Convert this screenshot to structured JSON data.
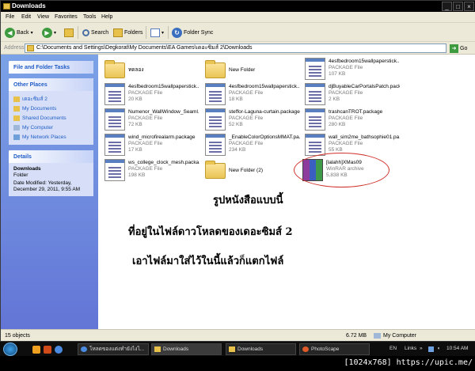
{
  "window": {
    "title": "Downloads",
    "controls": [
      "_",
      "□",
      "×"
    ]
  },
  "menu": [
    "File",
    "Edit",
    "View",
    "Favorites",
    "Tools",
    "Help"
  ],
  "toolbar": {
    "back": "Back",
    "search": "Search",
    "folders": "Folders",
    "folder_sync": "Folder Sync"
  },
  "address": {
    "label": "Address",
    "path": "C:\\Documents and Settings\\Degkorat\\My Documents\\EA Games\\เดอะซิมส์ 2\\Downloads",
    "go": "Go"
  },
  "sidebar": {
    "tasks_title": "File and Folder Tasks",
    "places_title": "Other Places",
    "places": [
      "เดอะซิมส์ 2",
      "My Documents",
      "Shared Documents",
      "My Computer",
      "My Network Places"
    ],
    "details_title": "Details",
    "details_name": "Downloads",
    "details_type": "Folder",
    "details_modified_1": "Date Modified: Yesterday,",
    "details_modified_2": "December 29, 2011, 9:55 AM"
  },
  "files": [
    {
      "name": "ทดลอง",
      "type": "",
      "size": "",
      "icon": "folder"
    },
    {
      "name": "New Folder",
      "type": "",
      "size": "",
      "icon": "folder"
    },
    {
      "name": "4esfbedroom15wallpaperstick...",
      "type": "PACKAGE File",
      "size": "107 KB",
      "icon": "package"
    },
    {
      "name": "4esfbedroom15wallpaperstick...",
      "type": "PACKAGE File",
      "size": "20 KB",
      "icon": "package"
    },
    {
      "name": "4esfbedroom15wallpaperstick...",
      "type": "PACKAGE File",
      "size": "18 KB",
      "icon": "package"
    },
    {
      "name": "djBuyableCarPortalsPatch.pack...",
      "type": "PACKAGE File",
      "size": "2 KB",
      "icon": "package"
    },
    {
      "name": "Numenor_WallWindow_Seaml...",
      "type": "PACKAGE File",
      "size": "72 KB",
      "icon": "package"
    },
    {
      "name": "steffor-Laguna-curtain.package",
      "type": "PACKAGE File",
      "size": "52 KB",
      "icon": "package"
    },
    {
      "name": "trashcanTROT.package",
      "type": "PACKAGE File",
      "size": "280 KB",
      "icon": "package"
    },
    {
      "name": "wind_microfirealarm.package",
      "type": "PACKAGE File",
      "size": "17 KB",
      "icon": "package"
    },
    {
      "name": "_EnableColorOptionsMMAT.pa...",
      "type": "PACKAGE File",
      "size": "234 KB",
      "icon": "package"
    },
    {
      "name": "wall_sim2me_bathsophie01.pa...",
      "type": "PACKAGE File",
      "size": "55 KB",
      "icon": "package"
    },
    {
      "name": "ws_college_clock_mesh.packa...",
      "type": "PACKAGE File",
      "size": "198 KB",
      "icon": "package"
    },
    {
      "name": "New Folder (2)",
      "type": "",
      "size": "",
      "icon": "folder"
    },
    {
      "name": "[lalahh]XMas09",
      "type": "WinRAR archive",
      "size": "5,838 KB",
      "icon": "winrar"
    }
  ],
  "annotation": {
    "line1": "รูปหนังสือแบบนี้",
    "line2": "ที่อยู่ในไฟล์ดาวโหลดของเดอะซิมส์ 2",
    "line3": "เอาไฟล์มาใส่ไว้ในนี้แล้วก็แตกไฟล์",
    "circle_color": "#d0302a"
  },
  "status": {
    "objects": "15 objects",
    "size": "6.72 MB",
    "location": "My Computer"
  },
  "taskbar": {
    "tasks": [
      "โหลดของแต่งทำยังไงไ...",
      "Downloads",
      "Downloads",
      "PhotoScape"
    ],
    "lang": "EN",
    "links": "Links",
    "time": "10:54 AM"
  },
  "watermark": "[1024x768] https://upic.me/"
}
